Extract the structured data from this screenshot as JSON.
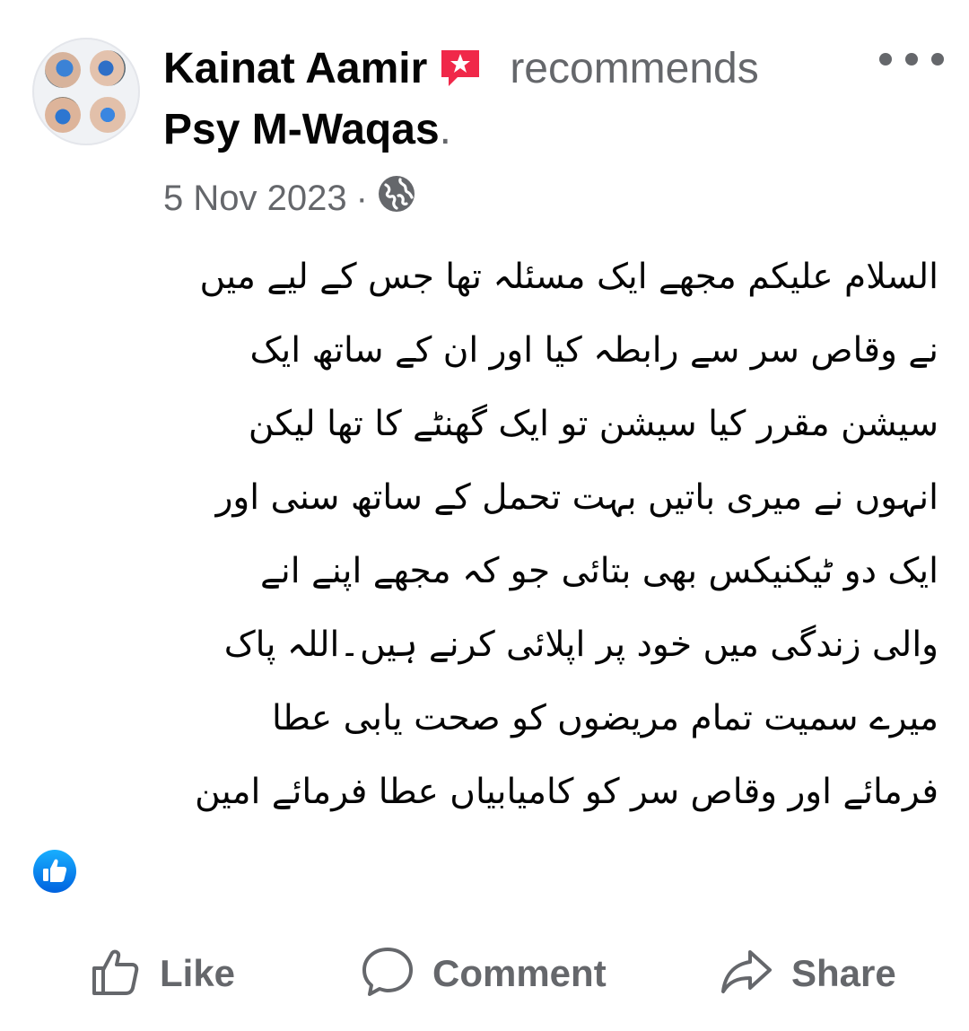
{
  "post": {
    "author": "Kainat Aamir",
    "action_text": "recommends",
    "page_name": "Psy M-Waqas",
    "page_name_suffix": ".",
    "date": "5 Nov 2023",
    "date_separator": "·",
    "audience_icon": "globe-icon",
    "badge_icon": "recommendation-badge-icon",
    "more_icon": "more-options-icon",
    "text_lines": [
      "السلام علیکم مجھے ایک مسئلہ تھا جس کے لیے میں",
      "نے وقاص سر سے رابطہ کیا اور ان کے ساتھ ایک",
      "سیشن مقرر کیا سیشن تو ایک گھنٹے کا تھا لیکن",
      "انہوں نے میری باتیں بہت تحمل کے ساتھ سنی اور",
      "ایک دو ٹیکنیکس بھی بتائی جو کہ مجھے اپنے انے",
      "والی زندگی میں خود پر اپلائی کرنے ہیں۔اللہ پاک",
      "میرے سمیت تمام مریضوں کو صحت یابی عطا",
      "فرمائے اور وقاص سر کو کامیابیاں عطا فرمائے امین"
    ],
    "reaction_icon": "like-reaction-icon"
  },
  "actions": {
    "like": "Like",
    "comment": "Comment",
    "share": "Share"
  },
  "colors": {
    "primary_text": "#050505",
    "secondary_text": "#65676b",
    "badge": "#f02849",
    "like_blue": "#1877f2"
  }
}
